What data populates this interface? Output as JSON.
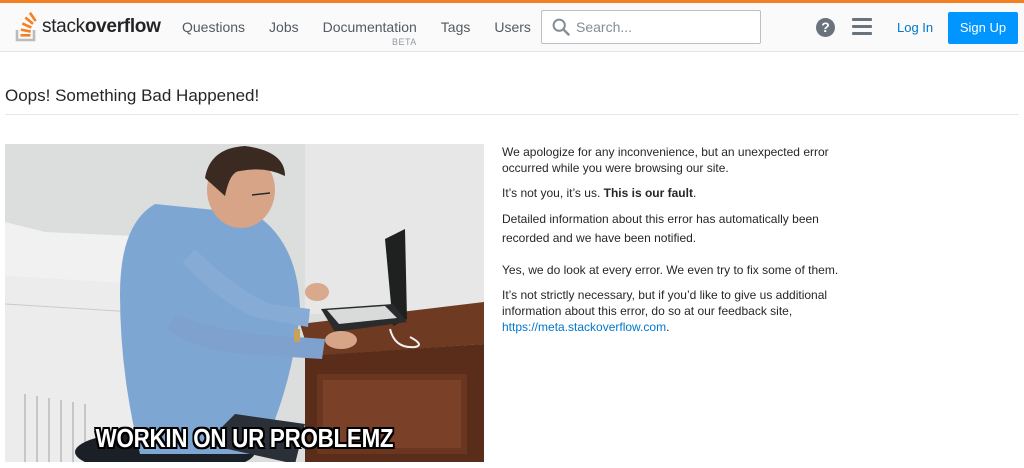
{
  "header": {
    "logo": {
      "prefix": "stack",
      "suffix": "overflow"
    },
    "nav": [
      {
        "label": "Questions"
      },
      {
        "label": "Jobs"
      },
      {
        "label": "Documentation",
        "badge": "BETA"
      },
      {
        "label": "Tags"
      },
      {
        "label": "Users"
      }
    ],
    "search": {
      "placeholder": "Search...",
      "value": ""
    },
    "help_glyph": "?",
    "login_label": "Log In",
    "signup_label": "Sign Up"
  },
  "page": {
    "title": "Oops! Something Bad Happened!"
  },
  "image": {
    "caption": "WORKIN ON UR PROBLEMZ"
  },
  "message": {
    "p1": "We apologize for any inconvenience, but an unexpected error occurred while you were browsing our site.",
    "p2_prefix": "It’s not you, it’s us. ",
    "p2_bold": "This is our fault",
    "p2_suffix": ".",
    "p3": "Detailed information about this error has automatically been recorded and we have been notified.",
    "p4": "Yes, we do look at every error. We even try to fix some of them.",
    "p5": "It’s not strictly necessary, but if you’d like to give us additional information about this error, do so at our feedback site,",
    "link_text": "https://meta.stackoverflow.com",
    "p5_end": "."
  },
  "colors": {
    "accent": "#f48024",
    "link": "#0077cc",
    "signup_bg": "#0095ff"
  }
}
